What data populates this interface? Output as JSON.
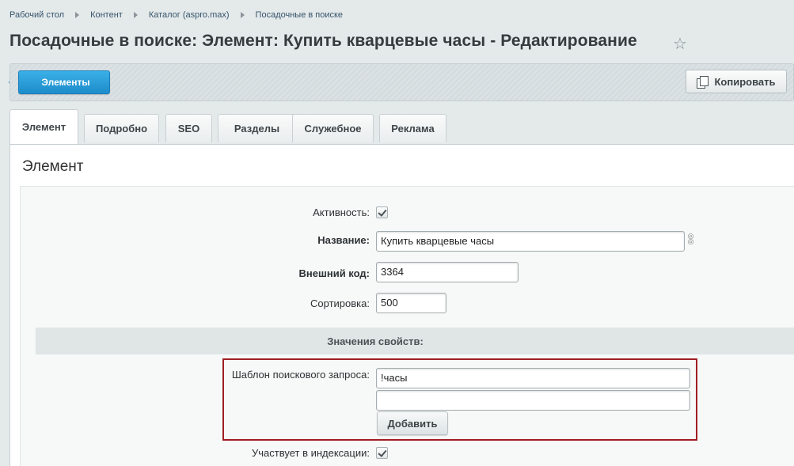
{
  "breadcrumb": [
    "Рабочий стол",
    "Контент",
    "Каталог (aspro.max)",
    "Посадочные в поиске"
  ],
  "title": "Посадочные в поиске: Элемент: Купить кварцевые часы - Редактирование",
  "toolbar": {
    "elements_label": "Элементы",
    "copy_label": "Копировать"
  },
  "tabs": [
    "Элемент",
    "Подробно",
    "SEO",
    "Разделы",
    "Служебное",
    "Реклама"
  ],
  "active_tab": "Элемент",
  "panel_heading": "Элемент",
  "form": {
    "active_label": "Активность:",
    "active_checked": true,
    "name_label": "Название:",
    "name_value": "Купить кварцевые часы",
    "ext_code_label": "Внешний код:",
    "ext_code_value": "3364",
    "sort_label": "Сортировка:",
    "sort_value": "500",
    "props_header": "Значения свойств:",
    "query_template_label": "Шаблон поискового запроса:",
    "query_values": [
      "!часы",
      ""
    ],
    "add_label": "Добавить",
    "indexing_label": "Участвует в индексации:",
    "indexing_checked": true
  },
  "colors": {
    "accent": "#1d8ccb",
    "highlight_border": "#a01e23"
  }
}
